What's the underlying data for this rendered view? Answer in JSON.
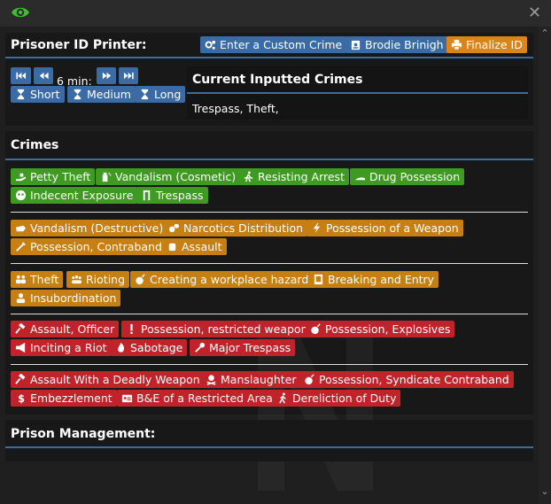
{
  "window": {
    "eye_icon": "eye-icon",
    "close_icon": "close-icon"
  },
  "printer": {
    "title": "Prisoner ID Printer:",
    "custom_crime_label": "Enter a Custom Crime",
    "prisoner_name": "Brodie Brinigh",
    "finalize_label": "Finalize ID",
    "time_label": "6 min:",
    "durations": [
      "Short",
      "Medium",
      "Long"
    ]
  },
  "current": {
    "title": "Current Inputted Crimes",
    "value": "Trespass, Theft,"
  },
  "crimes": {
    "title": "Crimes",
    "group1": [
      "Petty Theft",
      "Vandalism (Cosmetic)",
      "Resisting Arrest",
      "Drug Possession",
      "Indecent Exposure",
      "Trespass"
    ],
    "group2": [
      "Vandalism (Destructive)",
      "Narcotics Distribution",
      "Possession of a Weapon",
      "Possession, Contraband",
      "Assault"
    ],
    "group3": [
      "Theft",
      "Rioting",
      "Creating a workplace hazard",
      "Breaking and Entry",
      "Insubordination"
    ],
    "group4": [
      "Assault, Officer",
      "Possession, restricted weapon",
      "Possession, Explosives",
      "Inciting a Riot",
      "Sabotage",
      "Major Trespass"
    ],
    "group5": [
      "Assault With a Deadly Weapon",
      "Manslaughter",
      "Possession, Syndicate Contraband",
      "Embezzlement",
      "B&E of a Restricted Area",
      "Dereliction of Duty"
    ]
  },
  "management": {
    "title": "Prison Management:"
  },
  "colors": {
    "accent_blue": "#3a6ba4",
    "finalize_orange": "#d9851a",
    "tier1_green": "#3f9a21",
    "tier2_amber": "#c57f12",
    "tier3_red": "#c0242a",
    "divider_blue": "#3b6e9c"
  }
}
